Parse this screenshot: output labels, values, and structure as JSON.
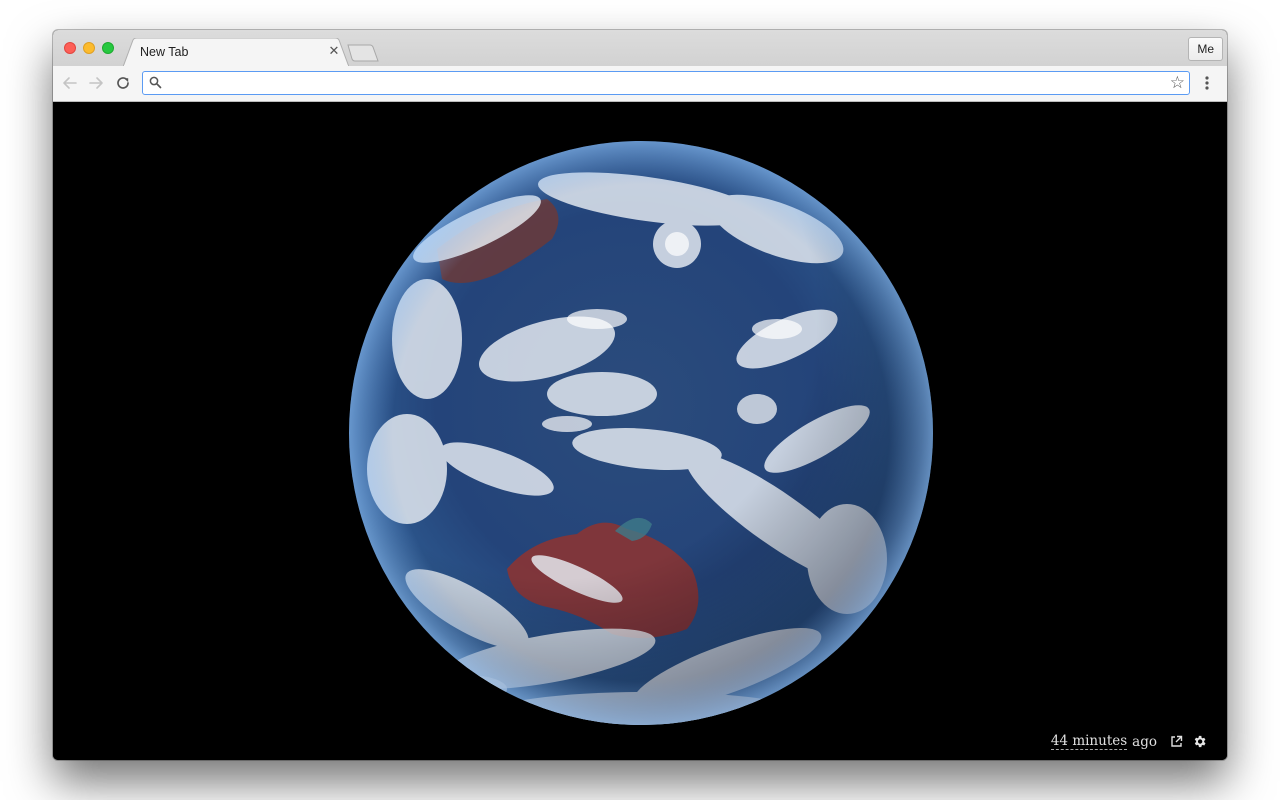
{
  "window": {
    "tab_title": "New Tab",
    "profile_label": "Me"
  },
  "toolbar": {
    "omnibox_value": ""
  },
  "footer": {
    "time_amount": "44 minutes",
    "time_suffix": "ago"
  },
  "icons": {
    "back": "arrow-back-icon",
    "forward": "arrow-forward-icon",
    "reload": "reload-icon",
    "search": "search-icon",
    "star": "star-icon",
    "menu": "kebab-menu-icon",
    "close_tab": "close-icon",
    "external_link": "external-link-icon",
    "settings": "gear-icon"
  },
  "colors": {
    "traffic_close": "#fd5f57",
    "traffic_minimize": "#fcbb2d",
    "traffic_maximize": "#27c840",
    "omnibox_focus": "#5b9bf3",
    "content_background": "#000000"
  }
}
